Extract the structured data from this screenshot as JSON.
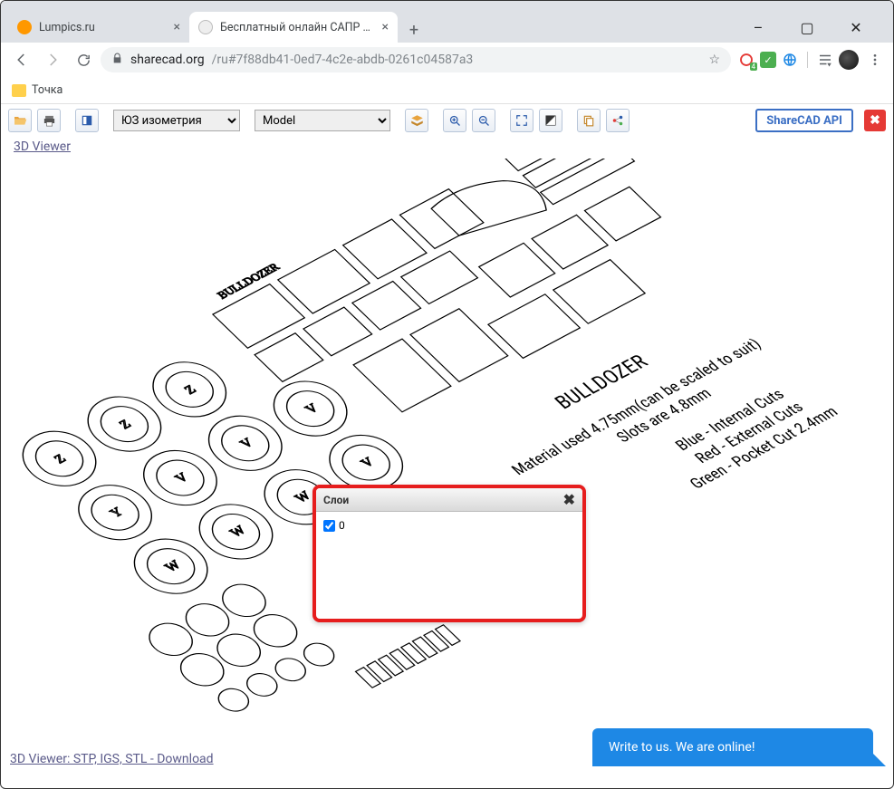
{
  "window": {
    "minimize": "–",
    "maximize": "▢",
    "close": "✕"
  },
  "tabs": [
    {
      "title": "Lumpics.ru",
      "favicon_color": "#ff9800"
    },
    {
      "title": "Бесплатный онлайн САПР прос",
      "favicon_color": "#9e9e9e"
    }
  ],
  "addressbar": {
    "host": "sharecad.org",
    "path": "/ru#7f88db41-0ed7-4c2e-abdb-0261c04587a3"
  },
  "bookmarks": [
    {
      "label": "Точка"
    }
  ],
  "toolbar": {
    "view_select": "ЮЗ изометрия",
    "model_select": "Model",
    "api_label": "ShareCAD API"
  },
  "links": {
    "viewer3d": "3D Viewer",
    "footer": "3D Viewer: STP, IGS, STL - Download"
  },
  "layers_dialog": {
    "title": "Слои",
    "items": [
      {
        "name": "0",
        "checked": true
      }
    ]
  },
  "chat": {
    "text": "Write to us. We are online!"
  },
  "cad_annotations": {
    "title": "BULLDOZER",
    "mat1": "Material used 4.75mm(can be scaled to suit)",
    "mat2": "Slots are 4.8mm",
    "leg1": "Blue - Internal Cuts",
    "leg2": "Red - External Cuts",
    "leg3": "Green - Pocket Cut 2.4mm"
  },
  "ext_badge": "4"
}
